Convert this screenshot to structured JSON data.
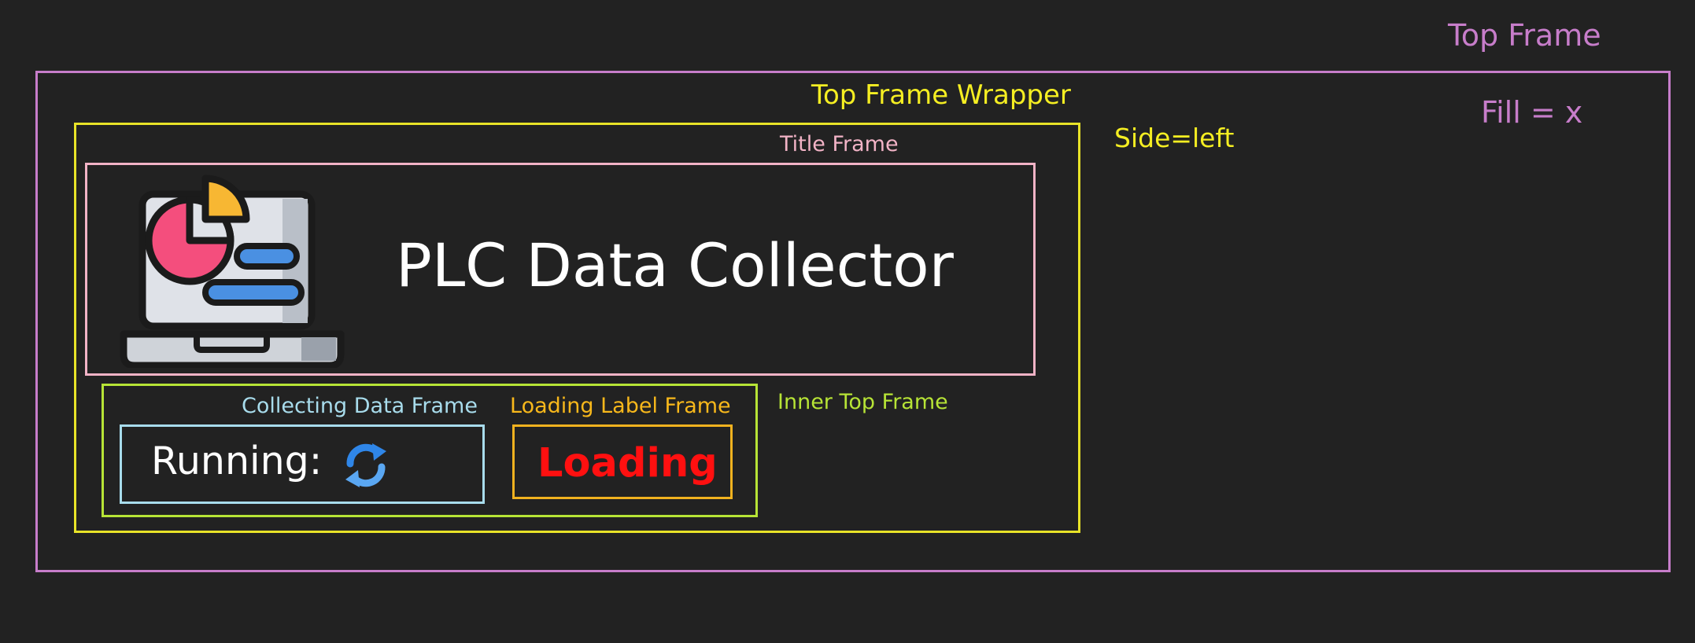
{
  "top_frame": {
    "label": "Top Frame",
    "fill_note": "Fill = x",
    "color": "#c77dca"
  },
  "wrapper_frame": {
    "label": "Top Frame Wrapper",
    "side_note": "Side=left",
    "color": "#e8e328"
  },
  "title_frame": {
    "label": "Title Frame",
    "app_title": "PLC Data Collector",
    "logo_icon": "laptop-chart-icon",
    "color": "#f2b3c6"
  },
  "inner_frame": {
    "label": "Inner Top Frame",
    "color": "#b7e436"
  },
  "collecting_frame": {
    "label": "Collecting Data Frame",
    "running_text": "Running:",
    "status_icon": "sync-icon",
    "color": "#a8dcec"
  },
  "loading_frame": {
    "label": "Loading Label Frame",
    "loading_text": "Loading",
    "text_color": "#ff1010",
    "color": "#f1b21f"
  }
}
